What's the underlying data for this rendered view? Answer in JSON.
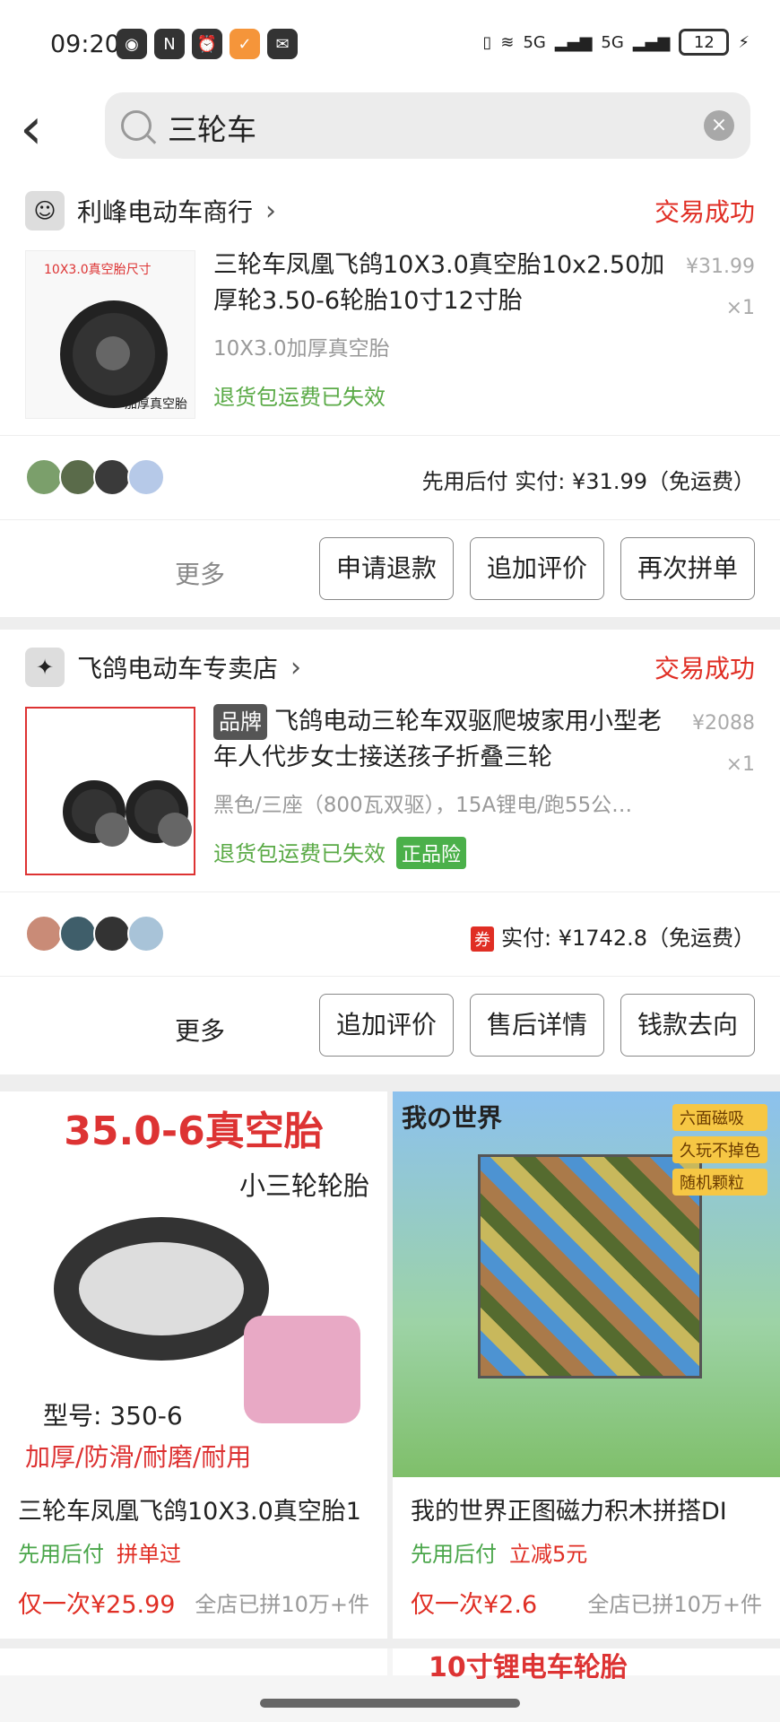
{
  "status": {
    "time": "09:20",
    "network": "5G",
    "battery": "12"
  },
  "search": {
    "query": "三轮车"
  },
  "orders": [
    {
      "shop": "利峰电动车商行",
      "status": "交易成功",
      "thumb_text": "10X3.0真空胎尺寸",
      "thumb_text2": "加厚真空胎",
      "title": "三轮车凤凰飞鸽10X3.0真空胎10x2.50加厚轮3.50-6轮胎10寸12寸胎",
      "spec": "10X3.0加厚真空胎",
      "refund": "退货包运费已失效",
      "price": "¥31.99",
      "qty": "×1",
      "paid": "先用后付 实付: ¥31.99（免运费）",
      "more": "更多",
      "buttons": [
        "申请退款",
        "追加评价",
        "再次拼单"
      ]
    },
    {
      "shop": "飞鸽电动车专卖店",
      "status": "交易成功",
      "brand": "品牌",
      "title": "飞鸽电动三轮车双驱爬坡家用小型老年人代步女士接送孩子折叠三轮",
      "spec": "黑色/三座（800瓦双驱），15A锂电/跑55公…",
      "refund": "退货包运费已失效",
      "badge": "正品险",
      "price": "¥2088",
      "qty": "×1",
      "coupon": "券",
      "paid": "实付: ¥1742.8（免运费）",
      "more": "更多",
      "buttons": [
        "追加评价",
        "售后详情",
        "钱款去向"
      ]
    }
  ],
  "products": [
    {
      "img_head": "35.0-6真空胎",
      "img_sub": "小三轮轮胎",
      "img_model": "型号: 350-6",
      "img_feat": "加厚/防滑/耐磨/耐用",
      "name": "三轮车凤凰飞鸽10X3.0真空胎1",
      "tag1": "先用后付",
      "tag2": "拼单过",
      "price": "仅一次¥25.99",
      "sold": "全店已拼10万+件"
    },
    {
      "img_head": "我の世界",
      "img_tags": [
        "六面磁吸",
        "久玩不掉色",
        "随机颗粒"
      ],
      "name": "我的世界正图磁力积木拼搭DI",
      "tag1": "先用后付",
      "tag2": "立减5元",
      "price": "仅一次¥2.6",
      "sold": "全店已拼10万+件"
    }
  ],
  "next_row": {
    "right_text": "10寸锂电车轮胎"
  }
}
